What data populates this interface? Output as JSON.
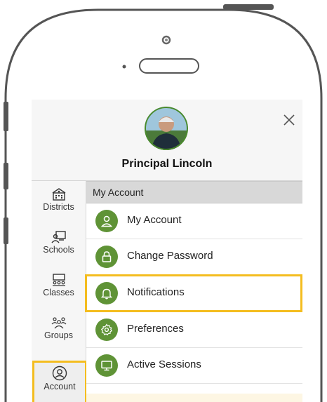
{
  "profile": {
    "name": "Principal Lincoln"
  },
  "sidebar": {
    "items": [
      {
        "label": "Districts",
        "icon": "district-building-icon"
      },
      {
        "label": "Schools",
        "icon": "school-icon"
      },
      {
        "label": "Classes",
        "icon": "classes-icon"
      },
      {
        "label": "Groups",
        "icon": "groups-icon"
      },
      {
        "label": "Account",
        "icon": "account-icon",
        "active": true
      }
    ]
  },
  "main": {
    "section_title": "My Account",
    "items": [
      {
        "label": "My Account",
        "icon": "person-icon"
      },
      {
        "label": "Change Password",
        "icon": "lock-icon"
      },
      {
        "label": "Notifications",
        "icon": "bell-icon",
        "highlighted": true
      },
      {
        "label": "Preferences",
        "icon": "gear-icon"
      },
      {
        "label": "Active Sessions",
        "icon": "monitor-icon"
      }
    ]
  },
  "colors": {
    "accent_green": "#5f9336",
    "highlight_yellow": "#f4bd1f"
  }
}
